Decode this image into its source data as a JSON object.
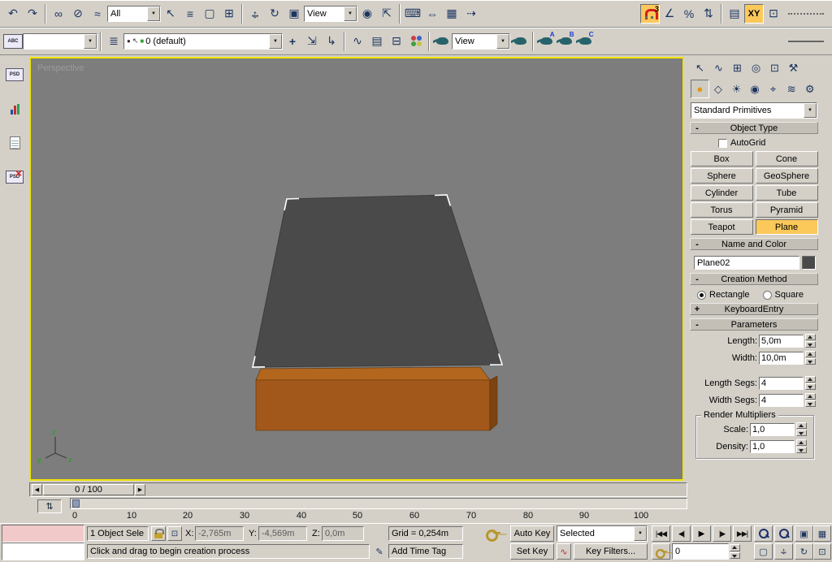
{
  "colors": {
    "highlight": "#fbc85a",
    "viewport_border": "#f0e400",
    "plane_fill": "#4a4a4a",
    "box_top": "#b2661e",
    "box_front": "#a2581a",
    "box_side": "#7c4410"
  },
  "icons": {
    "undo": "↶",
    "redo": "↷",
    "select_link": "∞",
    "unlink": "⊘",
    "bind_spacewarp": "≈",
    "select": "↖",
    "select_by_name": "≡",
    "region_select": "▢",
    "window_crossing": "⊞",
    "move_h": "↔",
    "move_v": "↕",
    "rotate": "↻",
    "scale": "▣",
    "pivot_center": "◉",
    "manipulate": "⇱",
    "keyboard_override": "⌨",
    "mirror": "⇔",
    "array": "▦",
    "align": "⇢",
    "angle": "∠",
    "percent": "%",
    "spinner_snap": "⇅",
    "named_sets": "▤",
    "extras": "⊡",
    "abc": "ABC",
    "layers": "≣",
    "eye": "●",
    "layer_cursor": "↖",
    "layer_chip": "■",
    "add_layer": "+",
    "grab_layer": "⇲",
    "select_layer": "↳",
    "curve_editor": "∿",
    "dope_sheet": "▤",
    "schematic": "⊟",
    "tab_create": "↖",
    "tab_modify": "∿",
    "tab_hierarchy": "⊞",
    "tab_motion": "◎",
    "tab_display": "⊡",
    "tab_utilities": "⚒",
    "cat_geometry": "●",
    "cat_shapes": "◇",
    "cat_lights": "☀",
    "cat_cameras": "◉",
    "cat_helpers": "⌖",
    "cat_spacewarps": "≋",
    "cat_systems": "⚙",
    "dd_arrow": "▼",
    "ts_left": "◀",
    "ts_right": "▶",
    "pb_start": "|◀◀",
    "pb_prev": "◀|",
    "pb_play": "▶",
    "pb_next": "|▶",
    "pb_end": "▶▶|",
    "nav_extents": "▣",
    "nav_extents_all": "▦",
    "nav_region": "▢",
    "nav_arc": "↻",
    "nav_max": "⊡",
    "trackbar_toggle": "⇅",
    "pen": "✎",
    "minus": "-",
    "plus": "+",
    "chart": "▁▃▅",
    "psd": "PSD"
  },
  "toolbar_top": {
    "selection_filter": "All",
    "reference_coordinate": "View",
    "snap_count": "3",
    "axis_constraint": "XY"
  },
  "toolbar_layers": {
    "named_selection": "",
    "layer": "0 (default)",
    "render_view": "View",
    "preset_a": "A",
    "preset_b": "B",
    "preset_c": "C"
  },
  "viewport": {
    "label": "Perspective",
    "axis": {
      "x": "x",
      "y": "y",
      "z": "z"
    }
  },
  "command_panel": {
    "category_dropdown": "Standard Primitives",
    "object_type": {
      "title": "Object Type",
      "autogrid": "AutoGrid",
      "buttons": [
        "Box",
        "Cone",
        "Sphere",
        "GeoSphere",
        "Cylinder",
        "Tube",
        "Torus",
        "Pyramid",
        "Teapot",
        "Plane"
      ],
      "active": "Plane"
    },
    "name_color": {
      "title": "Name and Color",
      "name": "Plane02"
    },
    "creation_method": {
      "title": "Creation Method",
      "options": [
        "Rectangle",
        "Square"
      ],
      "selected": "Rectangle"
    },
    "keyboard_entry": {
      "title": "KeyboardEntry"
    },
    "parameters": {
      "title": "Parameters",
      "length_label": "Length:",
      "length": "5,0m",
      "width_label": "Width:",
      "width": "10,0m",
      "length_segs_label": "Length Segs:",
      "length_segs": "4",
      "width_segs_label": "Width Segs:",
      "width_segs": "4",
      "render_multipliers": {
        "title": "Render Multipliers",
        "scale_label": "Scale:",
        "scale": "1,0",
        "density_label": "Density:",
        "density": "1,0"
      }
    }
  },
  "timeline": {
    "slider": "0 / 100",
    "ticks": [
      "0",
      "10",
      "20",
      "30",
      "40",
      "50",
      "60",
      "70",
      "80",
      "90",
      "100"
    ]
  },
  "status_bar": {
    "selection": "1 Object Sele",
    "x_label": "X:",
    "x": "-2,765m",
    "y_label": "Y:",
    "y": "-4,569m",
    "z_label": "Z:",
    "z": "0,0m",
    "grid": "Grid = 0,254m",
    "prompt": "Click and drag to begin creation process",
    "add_time_tag": "Add Time Tag"
  },
  "animation": {
    "auto_key": "Auto Key",
    "set_key": "Set Key",
    "key_mode": "Selected",
    "key_filters": "Key Filters...",
    "frame": "0"
  }
}
